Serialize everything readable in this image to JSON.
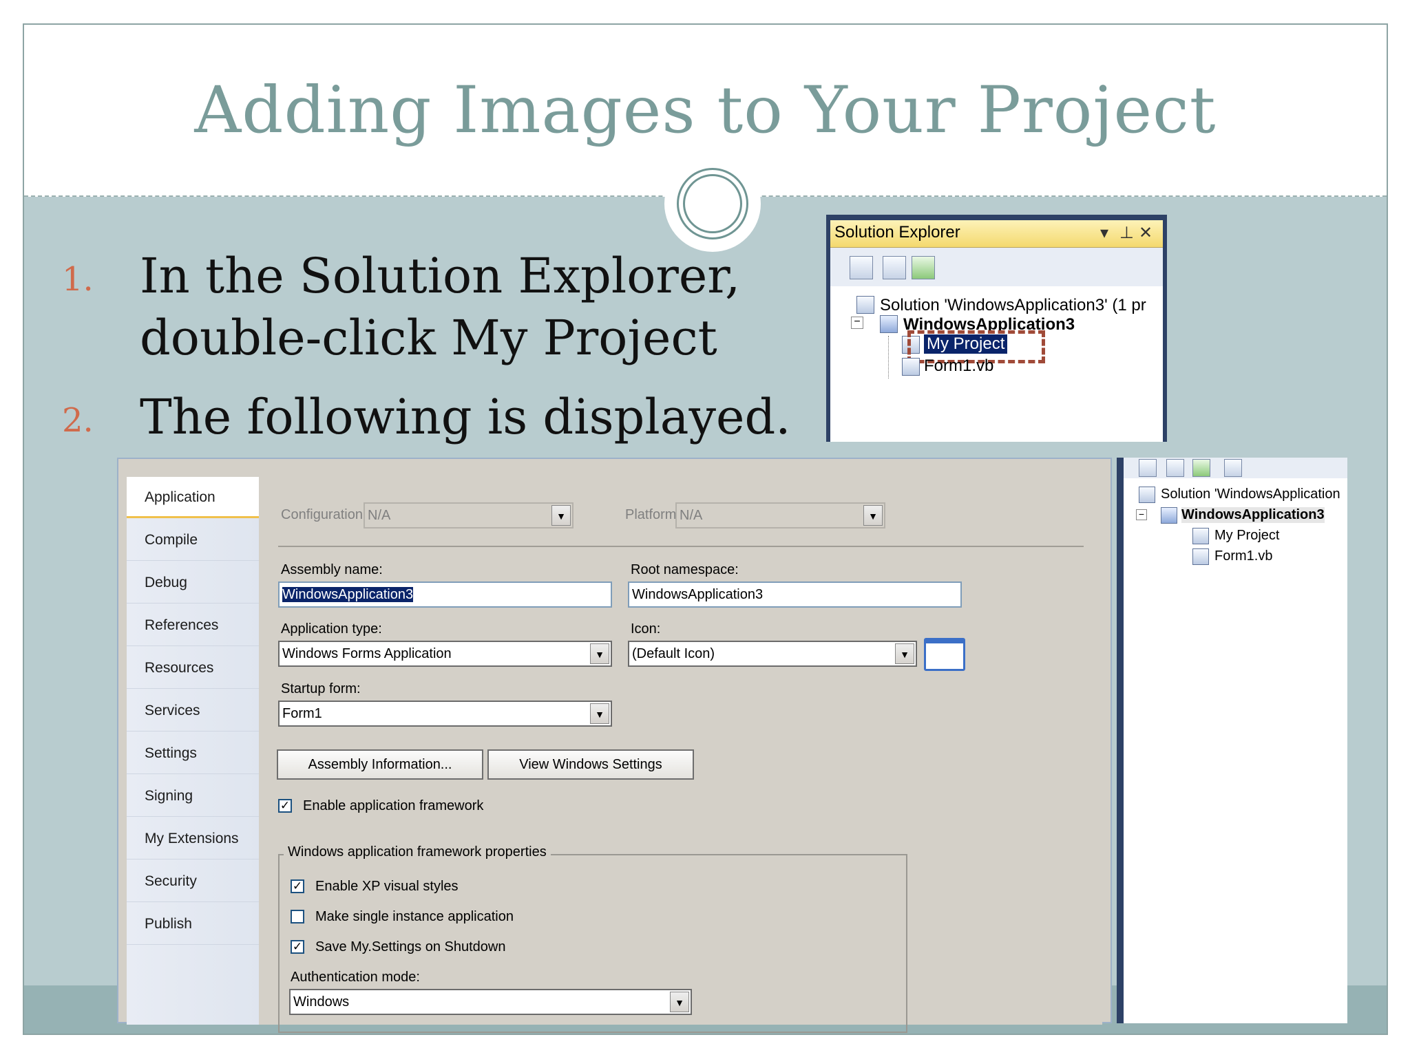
{
  "slide": {
    "title": "Adding Images to Your Project",
    "items": [
      {
        "num": "1.",
        "line1": "In the Solution Explorer,",
        "line2": "double-click My Project"
      },
      {
        "num": "2.",
        "line1": "The following is displayed."
      }
    ]
  },
  "solution_explorer": {
    "title": "Solution Explorer",
    "solution_label": "Solution 'WindowsApplication3' (1 pr",
    "project_label": "WindowsApplication3",
    "my_project_label": "My Project",
    "form_label": "Form1.vb",
    "expand_glyph": "−",
    "controls": {
      "dropdown": "▾",
      "pin": "⊥",
      "close": "✕"
    }
  },
  "property_pages": {
    "nav": [
      "Application",
      "Compile",
      "Debug",
      "References",
      "Resources",
      "Services",
      "Settings",
      "Signing",
      "My Extensions",
      "Security",
      "Publish"
    ],
    "active_tab": "Application",
    "configuration_label": "Configuration:",
    "configuration_value": "N/A",
    "platform_label": "Platform:",
    "platform_value": "N/A",
    "assembly_name_label": "Assembly name:",
    "assembly_name_value": "WindowsApplication3",
    "root_namespace_label": "Root namespace:",
    "root_namespace_value": "WindowsApplication3",
    "application_type_label": "Application type:",
    "application_type_value": "Windows Forms Application",
    "icon_label": "Icon:",
    "icon_value": "(Default Icon)",
    "startup_form_label": "Startup form:",
    "startup_form_value": "Form1",
    "assembly_info_button": "Assembly Information...",
    "view_windows_settings_button": "View Windows Settings",
    "enable_framework_label": "Enable application framework",
    "framework_group_label": "Windows application framework properties",
    "xp_styles_label": "Enable XP visual styles",
    "single_instance_label": "Make single instance application",
    "save_settings_label": "Save My.Settings on Shutdown",
    "auth_mode_label": "Authentication mode:",
    "auth_mode_value": "Windows",
    "check_mark": "✓",
    "dropdown_glyph": "▼"
  },
  "solution_explorer_right": {
    "solution_label": "Solution 'WindowsApplication",
    "project_label": "WindowsApplication3",
    "my_project_label": "My Project",
    "form_label": "Form1.vb",
    "expand_glyph": "−"
  },
  "colors": {
    "title": "#7a9c9a",
    "number": "#d06a4b",
    "highlight_box": "#a04a38",
    "selection": "#0a246a"
  }
}
